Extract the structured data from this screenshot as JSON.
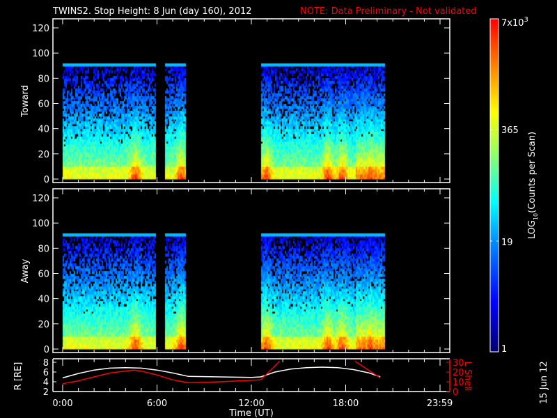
{
  "title": {
    "main": "TWINS2. Stop Height:  8 Jun (day 160), 2012",
    "note": "NOTE: Data Preliminary - Not validated",
    "side_date": "15 Jun 12"
  },
  "colors": {
    "note": "#ff0000",
    "axis": "#ffffff",
    "lshell": "#ff0000",
    "radius": "#ffffff"
  },
  "chart_data": [
    {
      "type": "heatmap",
      "name": "Toward",
      "ylabel": "Toward",
      "ylim": [
        0,
        127
      ],
      "yticks": [
        "0",
        "20",
        "40",
        "60",
        "80",
        "100",
        "120"
      ],
      "xlim_hours": [
        0,
        24
      ],
      "max_energy_filled": 92,
      "data_intervals_hours": [
        [
          0.0,
          5.9
        ],
        [
          6.5,
          7.75
        ],
        [
          12.6,
          20.4
        ]
      ],
      "enhancements_hours": [
        4.6,
        7.5,
        12.9,
        16.8,
        17.7,
        19.5
      ]
    },
    {
      "type": "heatmap",
      "name": "Away",
      "ylabel": "Away",
      "ylim": [
        0,
        127
      ],
      "yticks": [
        "0",
        "20",
        "40",
        "60",
        "80",
        "100",
        "120"
      ],
      "xlim_hours": [
        0,
        24
      ],
      "max_energy_filled": 92,
      "data_intervals_hours": [
        [
          0.0,
          5.9
        ],
        [
          6.5,
          7.75
        ],
        [
          12.6,
          20.4
        ]
      ],
      "enhancements_hours": [
        4.6,
        7.5,
        12.9,
        16.8,
        17.7,
        19.5
      ]
    },
    {
      "type": "line",
      "name": "orbit",
      "ylabel_left": "R [RE]",
      "ylabel_left_sub": "E",
      "ylabel_right": "L Shell",
      "ylim_left": [
        2,
        8
      ],
      "yticks_left": [
        "2",
        "4",
        "6",
        "8"
      ],
      "ylim_right": [
        0,
        30
      ],
      "yticks_right": [
        "0",
        "10",
        "20",
        "30"
      ],
      "series": [
        {
          "name": "R",
          "x": [
            0,
            1,
            2,
            3,
            4,
            5,
            6,
            7,
            8,
            10,
            12,
            12.6,
            13.5,
            14.5,
            15.5,
            16.5,
            17.5,
            18.5,
            19.5,
            20.2
          ],
          "y": [
            4.8,
            5.7,
            6.4,
            6.8,
            6.9,
            6.8,
            6.4,
            5.8,
            5.1,
            5.0,
            4.9,
            5.0,
            6.0,
            6.6,
            6.9,
            7.0,
            6.9,
            6.5,
            5.8,
            5.0
          ]
        },
        {
          "name": "L Shell",
          "x": [
            0,
            1,
            2,
            3,
            4,
            4.5,
            5,
            6,
            7,
            8,
            10,
            12,
            12.6,
            13.8
          ],
          "y": [
            8,
            11,
            15,
            19,
            21,
            22,
            21,
            17,
            12,
            9,
            10,
            11.5,
            12,
            31
          ]
        },
        {
          "name": "L Shell (return)",
          "x": [
            18.6,
            20.2
          ],
          "y": [
            31,
            14
          ]
        }
      ]
    }
  ],
  "xaxis": {
    "ticks": [
      "0:00",
      "6:00",
      "12:00",
      "18:00",
      "23:59"
    ],
    "label": "Time (UT)"
  },
  "colorbar": {
    "labels": [
      "7x10",
      "3",
      "365",
      "19",
      "1"
    ],
    "label_log": "LOG",
    "label_sub": "10",
    "label_rest": "(Counts per Scan)"
  }
}
